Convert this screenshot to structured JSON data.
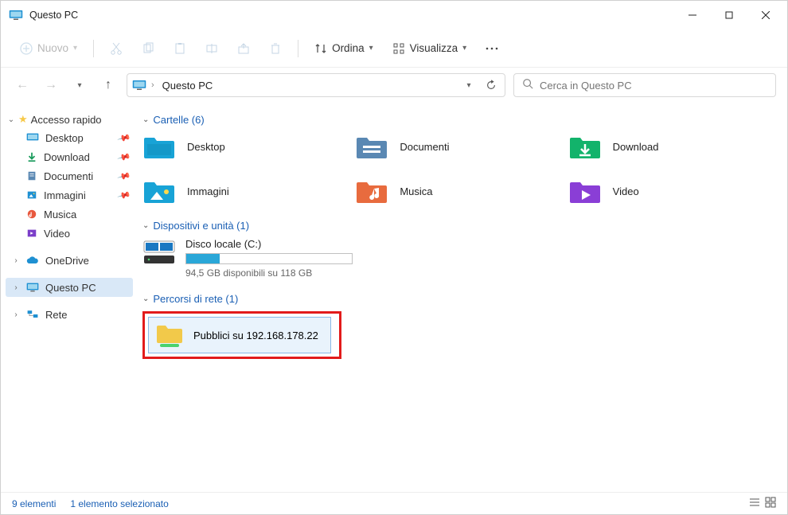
{
  "window": {
    "title": "Questo PC"
  },
  "toolbar": {
    "new_label": "Nuovo",
    "sort_label": "Ordina",
    "view_label": "Visualizza"
  },
  "nav": {
    "breadcrumb": "Questo PC"
  },
  "search": {
    "placeholder": "Cerca in Questo PC"
  },
  "sidebar": {
    "quick_access": "Accesso rapido",
    "items": [
      {
        "label": "Desktop",
        "icon": "desktop"
      },
      {
        "label": "Download",
        "icon": "download"
      },
      {
        "label": "Documenti",
        "icon": "documents"
      },
      {
        "label": "Immagini",
        "icon": "pictures"
      },
      {
        "label": "Musica",
        "icon": "music"
      },
      {
        "label": "Video",
        "icon": "video"
      }
    ],
    "onedrive": "OneDrive",
    "thispc": "Questo PC",
    "network": "Rete"
  },
  "sections": {
    "folders": {
      "title": "Cartelle (6)",
      "items": [
        {
          "label": "Desktop",
          "icon": "desktop"
        },
        {
          "label": "Documenti",
          "icon": "documents"
        },
        {
          "label": "Download",
          "icon": "download"
        },
        {
          "label": "Immagini",
          "icon": "pictures"
        },
        {
          "label": "Musica",
          "icon": "music"
        },
        {
          "label": "Video",
          "icon": "video"
        }
      ]
    },
    "drives": {
      "title": "Dispositivi e unità (1)",
      "items": [
        {
          "label": "Disco locale (C:)",
          "free_text": "94,5 GB disponibili su 118 GB",
          "fill_percent": 20
        }
      ]
    },
    "network": {
      "title": "Percorsi di rete (1)",
      "items": [
        {
          "label": "Pubblici su 192.168.178.22"
        }
      ]
    }
  },
  "statusbar": {
    "count": "9 elementi",
    "selection": "1 elemento selezionato"
  }
}
